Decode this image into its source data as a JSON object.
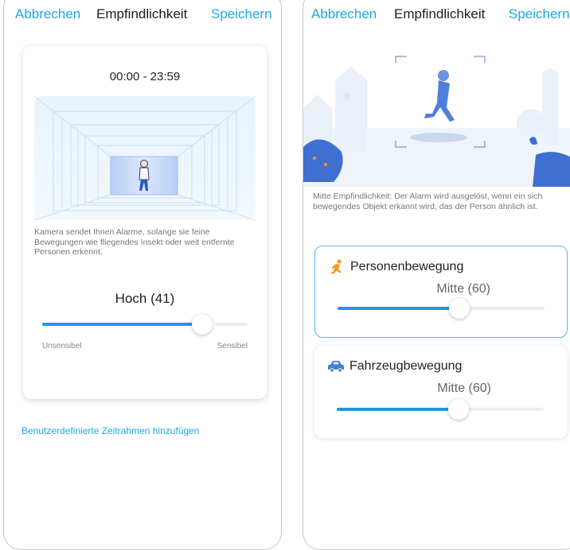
{
  "left_screen": {
    "header": {
      "cancel_label": "Abbrechen",
      "title": "Empfindlichkeit",
      "save_label": "Speichern"
    },
    "schedule": {
      "time_range": "00:00 - 23:59",
      "description": "Kamera sendet Ihnen Alarme, solange sie feine Bewegungen wie fliegendes Insekt oder weit entfernte Personen erkennt.",
      "level_label": "Hoch (41)",
      "slider_value_percent": 72,
      "min_label": "Unsensibel",
      "max_label": "Sensibel"
    },
    "add_timeframe_link": "Benutzerdefinierte Zeitrahmen hinzufügen"
  },
  "right_screen": {
    "header": {
      "cancel_label": "Abbrechen",
      "title": "Empfindlichkeit",
      "save_label": "Speichern"
    },
    "description": "Mitte Empfindlichkeit: Der Alarm wird ausgelöst, wenn ein sich bewegendes Objekt erkannt wird, das der Person ähnlich ist.",
    "modes": [
      {
        "label": "Personenbewegung",
        "value": "Mitte (60)",
        "selected": true,
        "icon": "running-person-icon",
        "slider_value_percent": 55
      },
      {
        "label": "Fahrzeugbewegung",
        "value": "Mitte (60)",
        "selected": false,
        "icon": "car-icon",
        "slider_value_percent": 55
      }
    ]
  },
  "colors": {
    "accent": "#1fa6e6",
    "slider_fill": "#1b9ae0",
    "selected_border": "#58b9ea",
    "person_icon": "#f29a1f",
    "car_icon": "#4a7fd0"
  }
}
